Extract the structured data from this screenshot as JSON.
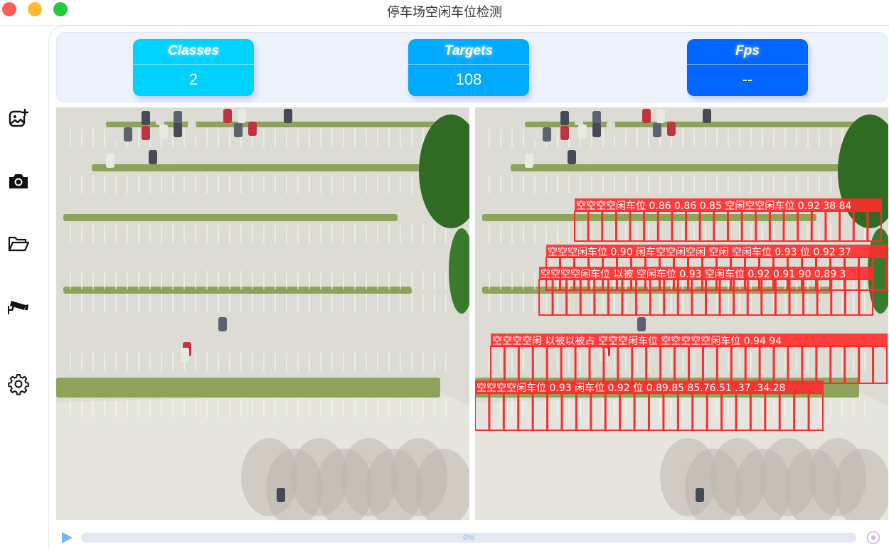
{
  "window": {
    "title": "停车场空闲车位检测"
  },
  "sidebar": {
    "items": [
      {
        "icon": "image-add-icon"
      },
      {
        "icon": "camera-icon"
      },
      {
        "icon": "folder-open-icon"
      },
      {
        "icon": "security-camera-icon"
      },
      {
        "icon": "gear-icon"
      }
    ]
  },
  "stats": {
    "classes": {
      "label": "Classes",
      "value": "2",
      "color": "#00d2ff"
    },
    "targets": {
      "label": "Targets",
      "value": "108",
      "color": "#00aaff"
    },
    "fps": {
      "label": "Fps",
      "value": "--",
      "color": "#0066ff"
    }
  },
  "detections": {
    "box_color": "#ff2b2b",
    "rows": [
      "空空空空闲车位 0.86 0.86 0.85 空闲空空闲车位 0.92 38 84",
      "空空空闲车位 0.90 闲车空空闲空闲 空闲 空闲车位 0.93 位 0.92 37",
      "空空空空闲车位 以被 空闲车位 0.93 空闲车位 0.92 0.91 90 0.89 3",
      "空空空空闲 以被以被占 空空空闲车位 空空空空空闲车位 0.94 94",
      "空空空空闲车位 0.93 闲车位 0.92 位 0.89.85 85.76.51 .37 .34.28"
    ]
  },
  "playback": {
    "progress_percent": 0,
    "progress_label": "0%"
  }
}
